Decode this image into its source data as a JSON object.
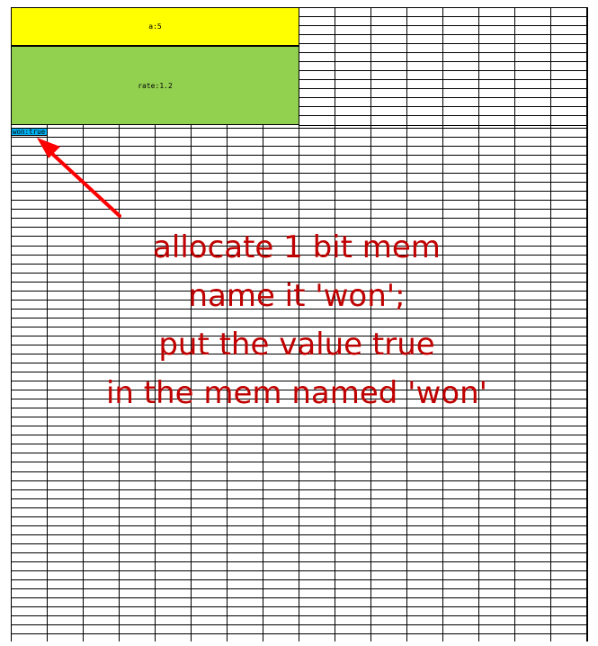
{
  "sheet": {
    "grid_color": "#000000",
    "background": "#ffffff"
  },
  "memory_blocks": [
    {
      "id": "a",
      "label": "a:5",
      "color": "#ffff00"
    },
    {
      "id": "rate",
      "label": "rate:1.2",
      "color": "#92d050"
    },
    {
      "id": "won",
      "label": "won:true",
      "color": "#00b0f0"
    }
  ],
  "annotation": {
    "color": "#c00000",
    "lines": [
      "allocate 1 bit mem",
      "name it 'won';",
      "put the value true",
      "in the mem named 'won'"
    ]
  },
  "arrow": {
    "color": "#ff0000",
    "points_to": "won"
  }
}
